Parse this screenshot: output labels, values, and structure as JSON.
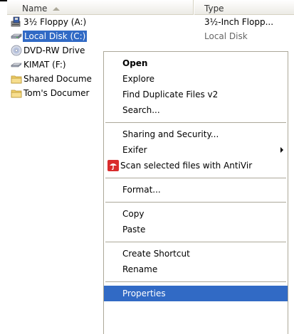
{
  "header": {
    "name_label": "Name",
    "type_label": "Type"
  },
  "files": [
    {
      "name": "3½ Floppy (A:)",
      "type": "3½-Inch Flopp...",
      "icon": "floppy-drive-icon",
      "selected": false
    },
    {
      "name": "Local Disk (C:)",
      "type": "Local Disk",
      "icon": "hard-disk-icon",
      "selected": true
    },
    {
      "name": "DVD-RW Drive",
      "type": "",
      "icon": "dvd-drive-icon",
      "selected": false
    },
    {
      "name": "KIMAT (F:)",
      "type": "",
      "icon": "removable-drive-icon",
      "selected": false
    },
    {
      "name": "Shared Docume",
      "type": "",
      "icon": "folder-icon",
      "selected": false
    },
    {
      "name": "Tom's Documer",
      "type": "",
      "icon": "folder-icon",
      "selected": false
    }
  ],
  "menu": {
    "open": "Open",
    "explore": "Explore",
    "find_duplicates": "Find Duplicate Files v2",
    "search": "Search...",
    "sharing": "Sharing and Security...",
    "exifer": "Exifer",
    "scan": "Scan selected files with AntiVir",
    "format": "Format...",
    "copy": "Copy",
    "paste": "Paste",
    "create_shortcut": "Create Shortcut",
    "rename": "Rename",
    "properties": "Properties"
  },
  "colors": {
    "selection": "#316ac5",
    "menu_border": "#aca899"
  }
}
